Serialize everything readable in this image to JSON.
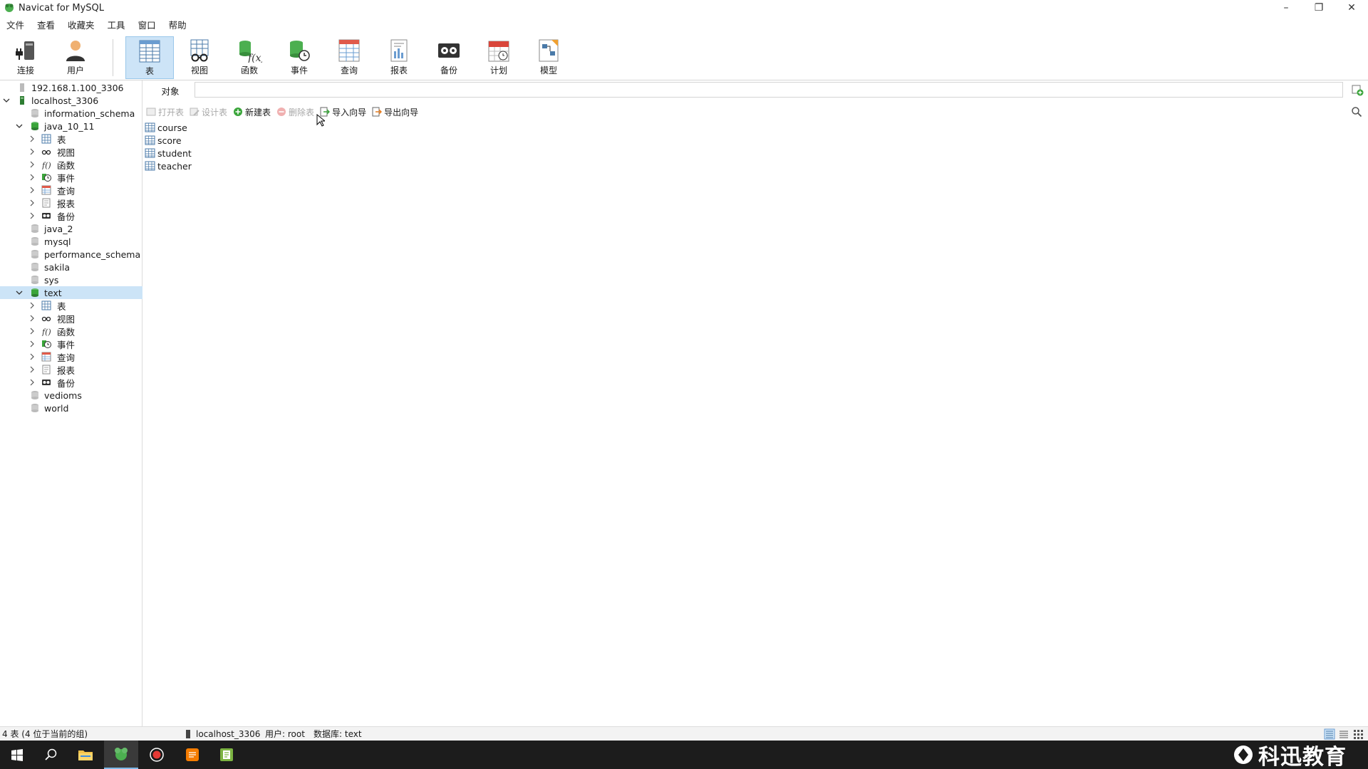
{
  "window": {
    "title": "Navicat for MySQL"
  },
  "menu": [
    "文件",
    "查看",
    "收藏夹",
    "工具",
    "窗口",
    "帮助"
  ],
  "ribbon": [
    {
      "label": "连接",
      "icon": "connection-icon"
    },
    {
      "label": "用户",
      "icon": "user-icon"
    },
    {
      "label": "表",
      "icon": "table-icon"
    },
    {
      "label": "视图",
      "icon": "view-icon"
    },
    {
      "label": "函数",
      "icon": "function-icon"
    },
    {
      "label": "事件",
      "icon": "event-icon"
    },
    {
      "label": "查询",
      "icon": "query-icon"
    },
    {
      "label": "报表",
      "icon": "report-icon"
    },
    {
      "label": "备份",
      "icon": "backup-icon"
    },
    {
      "label": "计划",
      "icon": "schedule-icon"
    },
    {
      "label": "模型",
      "icon": "model-icon"
    }
  ],
  "tree": {
    "connections": [
      {
        "label": "192.168.1.100_3306"
      },
      {
        "label": "localhost_3306"
      }
    ],
    "db_information_schema": "information_schema",
    "db_java_10_11": "java_10_11",
    "children_java": [
      "表",
      "视图",
      "函数",
      "事件",
      "查询",
      "报表",
      "备份"
    ],
    "db_java_2": "java_2",
    "db_mysql": "mysql",
    "db_performance_schema": "performance_schema",
    "db_sakila": "sakila",
    "db_sys": "sys",
    "db_text": "text",
    "children_text": [
      "表",
      "视图",
      "函数",
      "事件",
      "查询",
      "报表",
      "备份"
    ],
    "db_vedioms": "vedioms",
    "db_world": "world"
  },
  "objects_tab": "对象",
  "toolbar": {
    "open_table": "打开表",
    "design_table": "设计表",
    "new_table": "新建表",
    "delete_table": "删除表",
    "import_wizard": "导入向导",
    "export_wizard": "导出向导"
  },
  "tables": [
    "course",
    "score",
    "student",
    "teacher"
  ],
  "status": {
    "count": "4 表 (4 位于当前的组)",
    "connection": "localhost_3306",
    "user": "用户: root",
    "database": "数据库: text"
  },
  "watermark": "科迅教育",
  "colors": {
    "selection": "#cce4f7",
    "db_green": "#3aa53a",
    "taskbar": "#1c1c1c"
  }
}
